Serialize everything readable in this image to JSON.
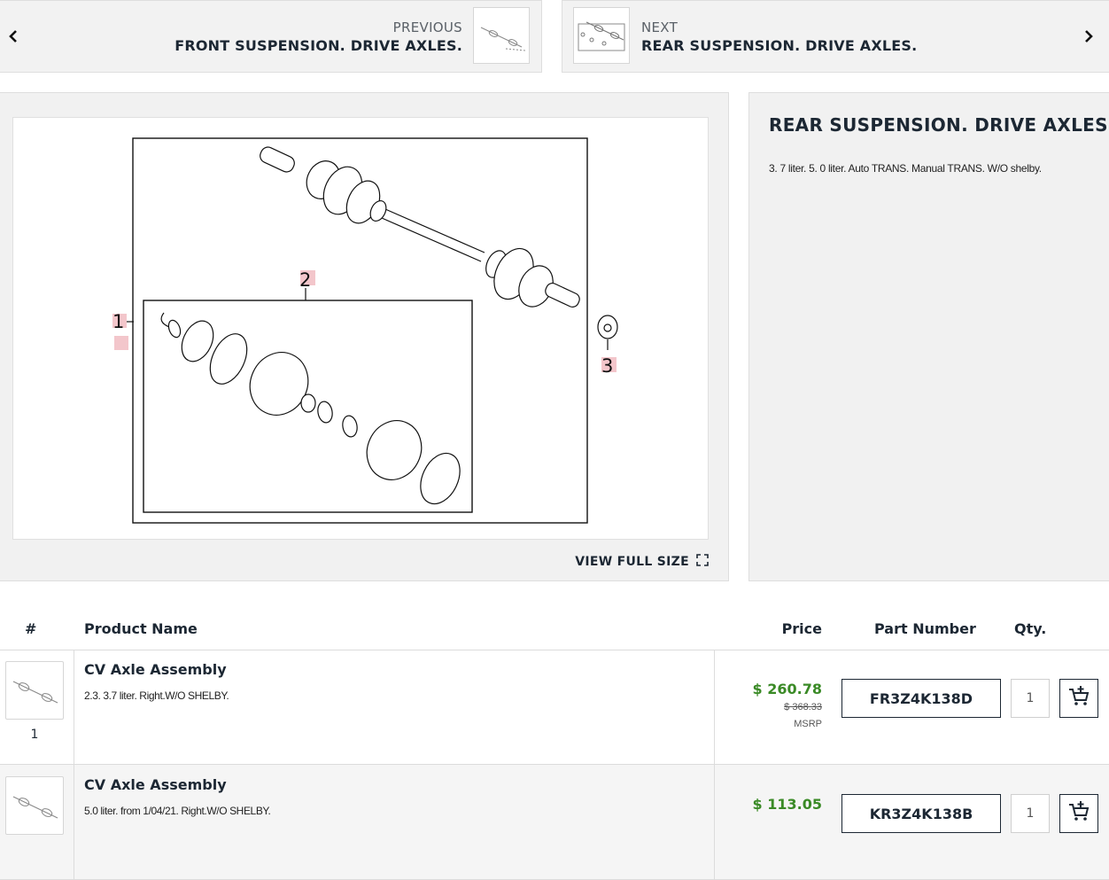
{
  "nav": {
    "prev": {
      "kicker": "PREVIOUS",
      "title": "FRONT SUSPENSION. DRIVE AXLES."
    },
    "next": {
      "kicker": "NEXT",
      "title": "REAR SUSPENSION. DRIVE AXLES."
    }
  },
  "diagram": {
    "callouts": [
      "1",
      "2",
      "3"
    ],
    "view_full_label": "VIEW FULL SIZE"
  },
  "info": {
    "title": "REAR SUSPENSION. DRIVE AXLES.",
    "description": "3. 7 liter. 5. 0 liter. Auto TRANS. Manual TRANS. W/O shelby."
  },
  "table": {
    "headers": {
      "num": "#",
      "product": "Product Name",
      "price": "Price",
      "part": "Part Number",
      "qty": "Qty."
    },
    "rows": [
      {
        "num": "1",
        "name": "CV Axle Assembly",
        "desc": "2.3. 3.7 liter. Right.W/O SHELBY.",
        "price": "$ 260.78",
        "msrp_value": "$ 368.33",
        "msrp_label": "MSRP",
        "part_number": "FR3Z4K138D",
        "qty": "1"
      },
      {
        "num": "",
        "name": "CV Axle Assembly",
        "desc": "5.0 liter. from 1/04/21. Right.W/O SHELBY.",
        "price": "$ 113.05",
        "msrp_value": "",
        "msrp_label": "",
        "part_number": "KR3Z4K138B",
        "qty": "1"
      }
    ]
  },
  "colors": {
    "price_green": "#3a8a26",
    "navy": "#1c2733",
    "callout_bg": "#f3c6cb"
  },
  "icons": {
    "prev": "chevron-left-icon",
    "next": "chevron-right-icon",
    "fullsize": "expand-icon",
    "cart": "add-to-cart-icon"
  }
}
